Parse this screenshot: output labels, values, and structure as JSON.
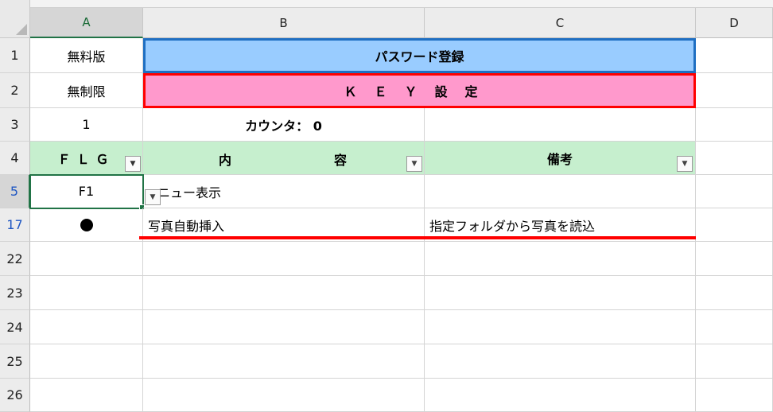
{
  "columns": [
    "A",
    "B",
    "C",
    "D"
  ],
  "rows": [
    "1",
    "2",
    "3",
    "4",
    "5",
    "17",
    "22",
    "23",
    "24",
    "25",
    "26"
  ],
  "cells": {
    "A1": "無料版",
    "B1": "パスワード登録",
    "A2": "無制限",
    "B2": "ＫＥＹ設定",
    "A3": "1",
    "B3": "カウンタ： 0",
    "A4": "ＦＬＧ",
    "B4_left": "内",
    "B4_right": "容",
    "C4": "備考",
    "A5": "F1",
    "B5": "ニュー表示",
    "A17": "●",
    "B17": "写真自動挿入",
    "C17": "指定フォルダから写真を読込"
  },
  "icons": {
    "filter_applied": "funnel-dropdown-icon",
    "filter_dropdown": "chevron-down-icon",
    "row17_marker": "filled-circle"
  },
  "colors": {
    "header_blue": "#99ccff",
    "header_blue_border": "#1f6fc2",
    "header_pink": "#ff99cc",
    "red_border": "#ff0000",
    "table_header_green": "#c6efce",
    "selection_green": "#217346"
  }
}
